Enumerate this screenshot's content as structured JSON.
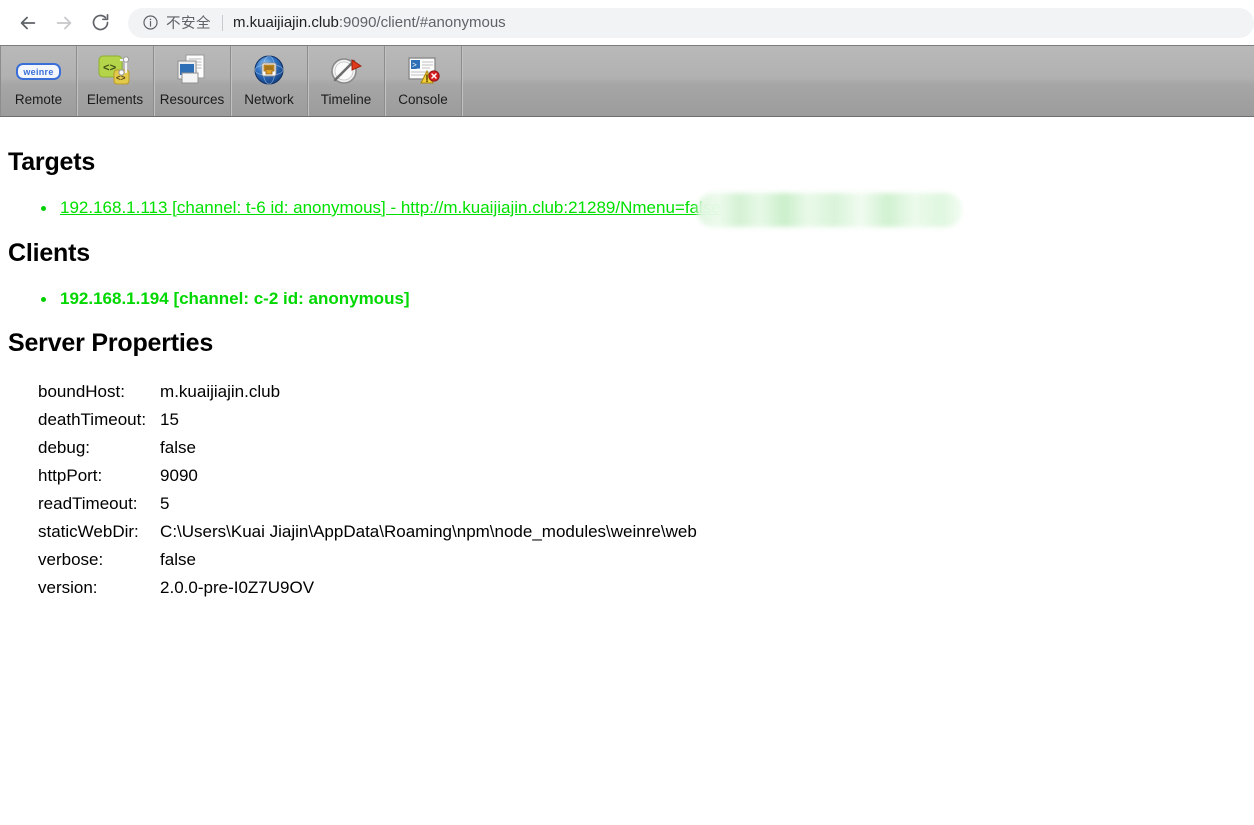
{
  "browser": {
    "back_icon": "back-arrow-icon",
    "forward_icon": "forward-arrow-icon",
    "reload_icon": "reload-icon",
    "security_icon": "info-circle-icon",
    "security_label": "不安全",
    "url_host": "m.kuaijiajin.club",
    "url_rest": ":9090/client/#anonymous",
    "url_full": "m.kuaijiajin.club:9090/client/#anonymous"
  },
  "devtools": {
    "panels": [
      {
        "label": "Remote",
        "icon": "weinre-logo-icon"
      },
      {
        "label": "Elements",
        "icon": "elements-code-tag-icon"
      },
      {
        "label": "Resources",
        "icon": "resources-documents-icon"
      },
      {
        "label": "Network",
        "icon": "network-globe-plug-icon"
      },
      {
        "label": "Timeline",
        "icon": "timeline-stopwatch-flag-icon"
      },
      {
        "label": "Console",
        "icon": "console-window-warning-icon"
      }
    ]
  },
  "sections": {
    "targets_heading": "Targets",
    "clients_heading": "Clients",
    "properties_heading": "Server Properties"
  },
  "targets": [
    {
      "label": "192.168.1.113 [channel: t-6 id: anonymous] - http://m.kuaijiajin.club:21289/N",
      "label_tail": "menu=false",
      "redacted": true
    }
  ],
  "clients": [
    {
      "label": "192.168.1.194 [channel: c-2 id: anonymous]"
    }
  ],
  "server_properties": [
    {
      "key": "boundHost:",
      "value": "m.kuaijiajin.club"
    },
    {
      "key": "deathTimeout:",
      "value": "15"
    },
    {
      "key": "debug:",
      "value": "false"
    },
    {
      "key": "httpPort:",
      "value": "9090"
    },
    {
      "key": "readTimeout:",
      "value": "5"
    },
    {
      "key": "staticWebDir:",
      "value": "C:\\Users\\Kuai Jiajin\\AppData\\Roaming\\npm\\node_modules\\weinre\\web"
    },
    {
      "key": "verbose:",
      "value": "false"
    },
    {
      "key": "version:",
      "value": "2.0.0-pre-I0Z7U9OV"
    }
  ],
  "colors": {
    "link_green": "#00e000",
    "client_green": "#00d800",
    "toolbar_gray": "#ababab",
    "omnibox_gray": "#f1f3f4",
    "text_dark": "#202124"
  }
}
